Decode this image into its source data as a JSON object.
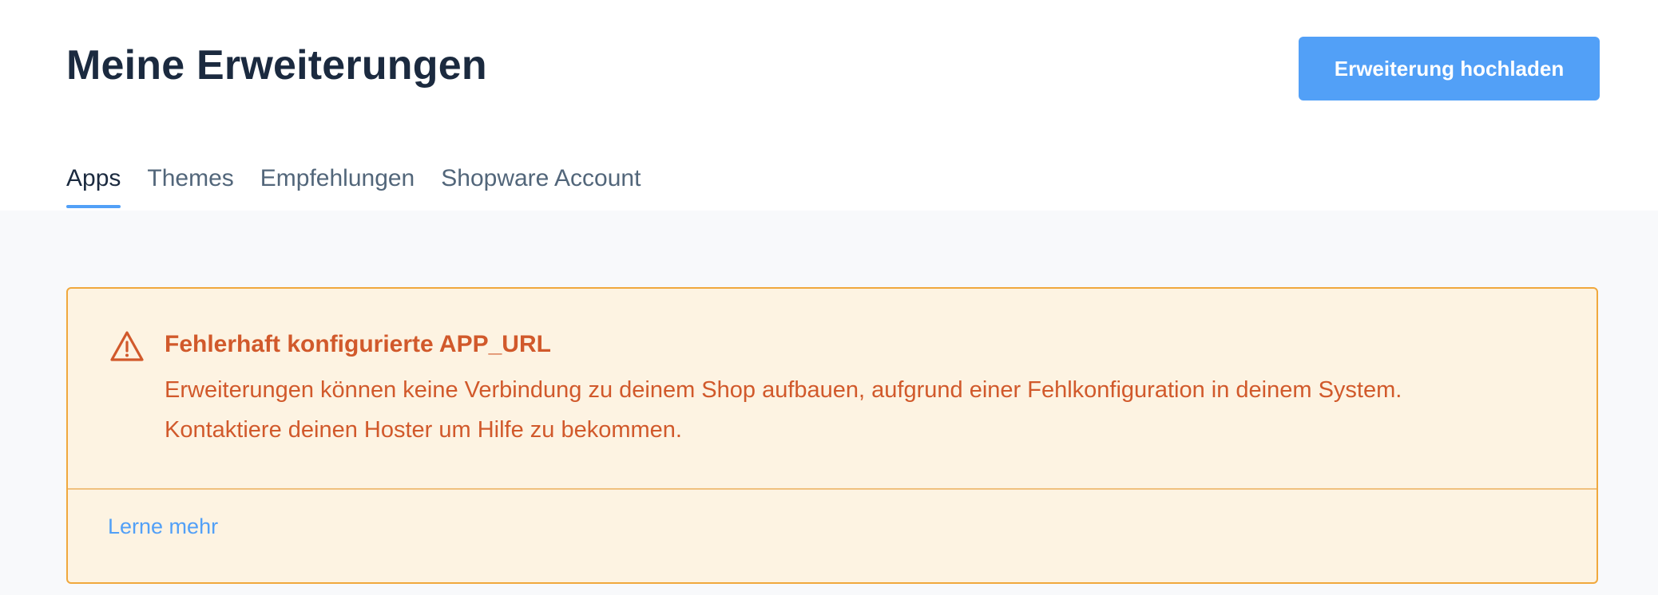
{
  "header": {
    "title": "Meine Erweiterungen",
    "upload_button_label": "Erweiterung hochladen"
  },
  "tabs": [
    {
      "label": "Apps",
      "active": true
    },
    {
      "label": "Themes",
      "active": false
    },
    {
      "label": "Empfehlungen",
      "active": false
    },
    {
      "label": "Shopware Account",
      "active": false
    }
  ],
  "alert": {
    "icon": "warning-triangle-icon",
    "title": "Fehlerhaft konfigurierte APP_URL",
    "message_line_1": "Erweiterungen können keine Verbindung zu deinem Shop aufbauen, aufgrund einer Fehlkonfiguration in deinem System.",
    "message_line_2": "Kontaktiere deinen Hoster um Hilfe zu bekommen.",
    "learn_more_label": "Lerne mehr"
  },
  "colors": {
    "accent": "#52a0f7",
    "title_text": "#1b2a3f",
    "warning_text": "#d1592b",
    "warning_background": "#fdf3e2",
    "warning_border": "#f0a83d"
  }
}
